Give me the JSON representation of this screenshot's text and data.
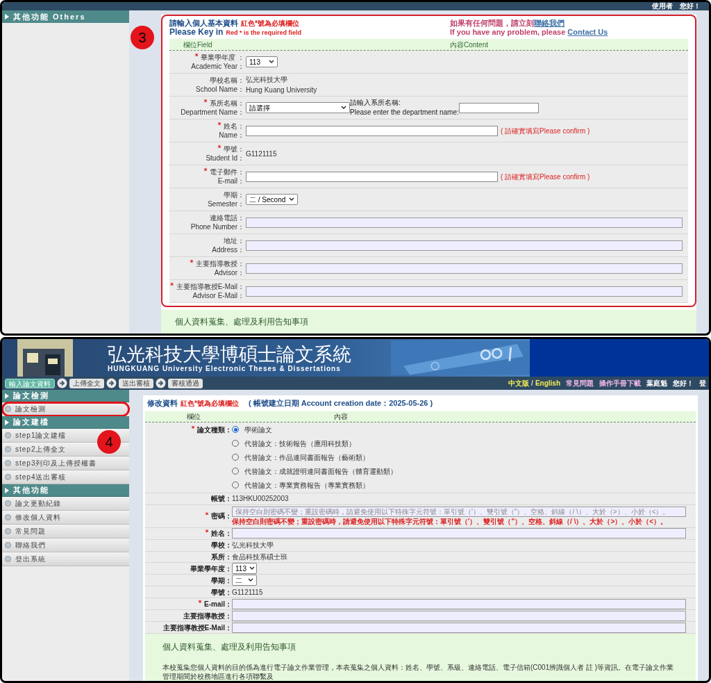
{
  "top_panel": {
    "greeting": "使用者　您好！",
    "sidebar": {
      "section": "其他功能 Others"
    },
    "annotation": "3",
    "form": {
      "title": "請輸入個人基本資料",
      "required_note": "紅色*號為必填欄位",
      "title_en": "Please Key in",
      "required_note_en": "Red * is the required field",
      "help_zh": "如果有任何問題，請立刻",
      "help_link_zh": "聯絡我們",
      "help_en": "If you have any problem, please ",
      "help_link_en": "Contact Us",
      "columns": [
        "欄位Field",
        "內容Content"
      ],
      "rows": [
        {
          "kind": "select",
          "label_zh": "畢業學年度 ：",
          "label_en": "Academic Year：",
          "required": true,
          "value": "113"
        },
        {
          "kind": "text",
          "label_zh": "學校名稱：",
          "label_en": "School Name：",
          "required": false,
          "value": "弘光科技大學",
          "value_en": "Hung Kuang University"
        },
        {
          "kind": "select_with_input",
          "label_zh": "系所名稱：",
          "label_en": "Department Name：",
          "required": true,
          "value": "請選擇",
          "extra_zh": "請輸入系所名稱:",
          "extra_en": "Please enter the department name:"
        },
        {
          "kind": "input_confirm",
          "label_zh": "姓名：",
          "label_en": "Name：",
          "required": true,
          "note": "( 請確實填寫Please confirm )"
        },
        {
          "kind": "plain",
          "label_zh": "學號：",
          "label_en": "Student Id：",
          "required": true,
          "value": "G1121115"
        },
        {
          "kind": "input_confirm",
          "label_zh": "電子郵件：",
          "label_en": "E-mail：",
          "required": true,
          "note": "( 請確實填寫Please confirm )"
        },
        {
          "kind": "select",
          "label_zh": "學期：",
          "label_en": "Semester：",
          "required": false,
          "value": "二 / Second"
        },
        {
          "kind": "input_wide",
          "label_zh": "連絡電話：",
          "label_en": "Phone Number：",
          "required": false
        },
        {
          "kind": "input_wide",
          "label_zh": "地址：",
          "label_en": "Address：",
          "required": false
        },
        {
          "kind": "input_wide",
          "label_zh": "主要指導教授：",
          "label_en": "Advisor：",
          "required": true
        },
        {
          "kind": "input_wide",
          "label_zh": "主要指導教授E-Mail：",
          "label_en": "Advisor E-Mail：",
          "required": true
        }
      ]
    },
    "notice_title": "個人資料蒐集、處理及利用告知事項"
  },
  "bottom_panel": {
    "banner": {
      "title": "弘光科技大學博碩士論文系統",
      "subtitle": "HUNGKUANG University Electronic Theses & Dissertations"
    },
    "steps": [
      {
        "label": "輸入論文資料",
        "selected": true
      },
      {
        "label": "上傳全文",
        "selected": false
      },
      {
        "label": "送出審核",
        "selected": false
      },
      {
        "label": "審核通過",
        "selected": false
      }
    ],
    "lang_zh": "中文版",
    "lang_sep": "/",
    "lang_en": "English",
    "links": [
      "常見問題",
      "操作手冊下載"
    ],
    "user": "葉庭魁",
    "greeting": "您好！",
    "logout": "登",
    "sidebar": [
      {
        "title": "論文檢測",
        "items": [
          {
            "label": "論文檢測",
            "highlighted": true
          }
        ]
      },
      {
        "title": "論文建檔",
        "items": [
          {
            "label": "step1論文建檔",
            "highlighted": false
          },
          {
            "label": "step2上傳全文",
            "highlighted": false
          },
          {
            "label": "step3列印及上傳授權書",
            "highlighted": false
          },
          {
            "label": "step4送出審核",
            "highlighted": false
          }
        ]
      },
      {
        "title": "其他功能",
        "items": [
          {
            "label": "論文更動紀錄",
            "highlighted": false
          },
          {
            "label": "修改個人資料",
            "highlighted": false
          },
          {
            "label": "常見問題",
            "highlighted": false
          },
          {
            "label": "聯絡我們",
            "highlighted": false
          },
          {
            "label": "登出系統",
            "highlighted": false
          }
        ]
      }
    ],
    "annotation": "4",
    "form": {
      "title": "修改資料",
      "required_note": "紅色*號為必填欄位",
      "creation": "( 帳號建立日期 Account creation date：2025-05-26 )",
      "columns": [
        "欄位",
        "內容"
      ],
      "rows": [
        {
          "kind": "radio",
          "label": "論文種類：",
          "required": true,
          "options": [
            {
              "label": "學術論文",
              "selected": true
            },
            {
              "label": "代替論文：技術報告（應用科技類）",
              "selected": false
            },
            {
              "label": "代替論文：作品連同書面報告（藝術類）",
              "selected": false
            },
            {
              "label": "代替論文：成就證明連同書面報告（體育運動類）",
              "selected": false
            },
            {
              "label": "代替論文：專業實務報告（專業實務類）",
              "selected": false
            }
          ]
        },
        {
          "kind": "plain",
          "label": "帳號：",
          "required": false,
          "value": "113HKU00252003"
        },
        {
          "kind": "password",
          "label": "密碼：",
          "required": true,
          "placeholder": "保持空白則密碼不變；重設密碼時，請避免使用以下特殊字元符號：單引號（'）、雙引號（\"）、空格、斜線（/ \\）、大於（>）、小於（<）。",
          "note": "保持空白則密碼不變；重設密碼時，請避免使用以下特殊字元符號：單引號（'）、雙引號（\"）、空格、斜線（/ \\）、大於（>）、小於（<）。"
        },
        {
          "kind": "input",
          "label": "姓名：",
          "required": true
        },
        {
          "kind": "plain",
          "label": "學校：",
          "required": false,
          "value": "弘光科技大學"
        },
        {
          "kind": "plain",
          "label": "系所：",
          "required": false,
          "value": "食品科技系碩士班"
        },
        {
          "kind": "select",
          "label": "畢業學年度：",
          "required": false,
          "value": "113"
        },
        {
          "kind": "select",
          "label": "學期：",
          "required": false,
          "value": "二"
        },
        {
          "kind": "plain",
          "label": "學號：",
          "required": false,
          "value": "G1121115"
        },
        {
          "kind": "input",
          "label": "E-mail：",
          "required": true
        },
        {
          "kind": "input",
          "label": "主要指導教授：",
          "required": false
        },
        {
          "kind": "input",
          "label": "主要指導教授E-Mail：",
          "required": false
        }
      ]
    },
    "notice_title": "個人資料蒐集、處理及利用告知事項",
    "notice_text": "本校蒐集您個人資料的目的係為進行電子論文作業管理，本表蒐集之個人資料：姓名、學號、系級、連絡電話、電子信箱(C001辨識個人者 註 )等資訊。在電子論文作業管理期間於校務地區進行各項聯繫及"
  }
}
